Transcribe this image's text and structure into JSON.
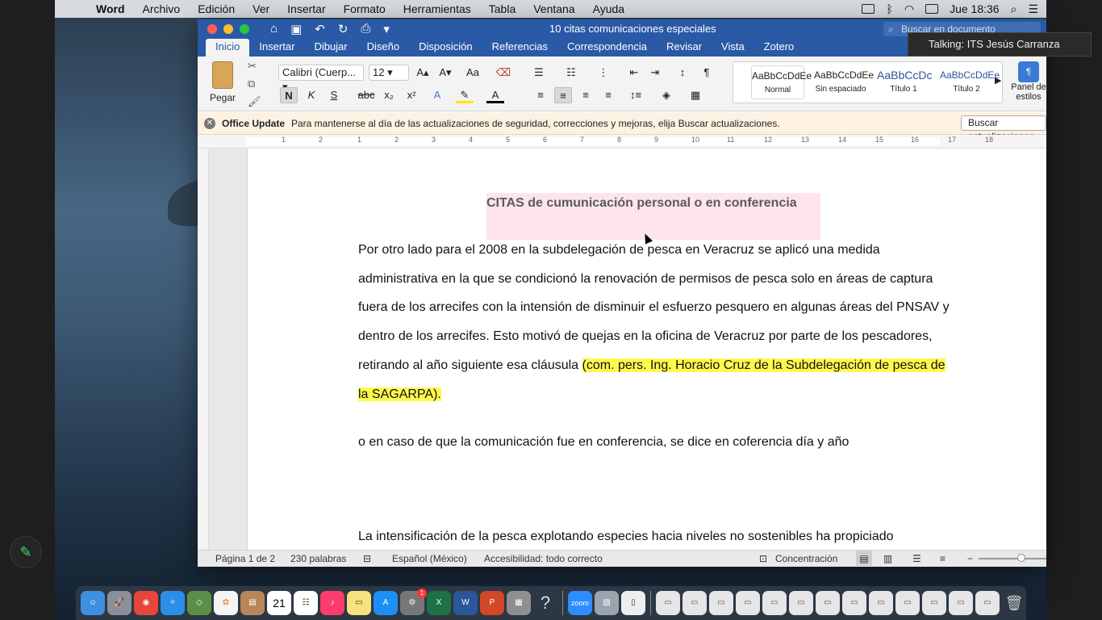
{
  "menubar": {
    "app": "Word",
    "items": [
      "Archivo",
      "Edición",
      "Ver",
      "Insertar",
      "Formato",
      "Herramientas",
      "Tabla",
      "Ventana",
      "Ayuda"
    ],
    "clock": "Jue 18:36"
  },
  "window": {
    "title": "10 citas comunicaciones especiales",
    "search_placeholder": "Buscar en documento",
    "tabs": [
      "Inicio",
      "Insertar",
      "Dibujar",
      "Diseño",
      "Disposición",
      "Referencias",
      "Correspondencia",
      "Revisar",
      "Vista",
      "Zotero"
    ],
    "ribbon": {
      "paste_label": "Pegar",
      "font_name": "Calibri (Cuerp...",
      "font_size": "12",
      "bold": "N",
      "italic": "K",
      "underline": "S",
      "strike": "abc",
      "styles": [
        {
          "preview": "AaBbCcDdEe",
          "name": "Normal"
        },
        {
          "preview": "AaBbCcDdEe",
          "name": "Sin espaciado"
        },
        {
          "preview": "AaBbCcDc",
          "name": "Título 1"
        },
        {
          "preview": "AaBbCcDdEe",
          "name": "Título 2"
        }
      ],
      "styles_pane": "Panel de estilos"
    },
    "update_bar": {
      "title": "Office Update",
      "message": "Para mantenerse al día de las actualizaciones de seguridad, correcciones y mejoras, elija Buscar actualizaciones.",
      "button": "Buscar actualizaciones"
    },
    "ruler_numbers": [
      "1",
      "2",
      "1",
      "2",
      "3",
      "4",
      "5",
      "6",
      "7",
      "8",
      "9",
      "10",
      "11",
      "12",
      "13",
      "14",
      "15",
      "16",
      "17",
      "18"
    ]
  },
  "document": {
    "heading": "CITAS de cumunicación personal o en conferencia",
    "para1_plain": "Por otro lado para el 2008 en la subdelegación de pesca en Veracruz se aplicó una medida administrativa en la que se condicionó la renovación de permisos de pesca solo en áreas de captura fuera de los arrecifes con la intensión de disminuir el esfuerzo pesquero en algunas áreas del PNSAV y dentro de los arrecifes. Esto motivó de quejas en la oficina de Veracruz por parte de los pescadores, retirando al año siguiente esa cláusula ",
    "para1_highlight": "(com. pers. Ing. Horacio Cruz de la Subdelegación de pesca de la SAGARPA).",
    "para2": "o en caso de que la comunicación fue en conferencia, se dice en coferencia día y año",
    "para3": "La intensificación de la pesca explotando especies hacia niveles no sostenibles ha propiciado"
  },
  "statusbar": {
    "page": "Página 1 de 2",
    "words": "230 palabras",
    "language": "Español (México)",
    "accessibility": "Accesibilidad: todo correcto",
    "focus": "Concentración"
  },
  "zoom_popup": "Talking: ITS Jesús Carranza",
  "dock": {
    "calendar_day": "21",
    "zoom_label": "zoom",
    "badge": "1"
  },
  "colors": {
    "word_blue": "#2a5aa6",
    "highlight": "#fff94d",
    "heading_bg": "#fde4ee"
  }
}
